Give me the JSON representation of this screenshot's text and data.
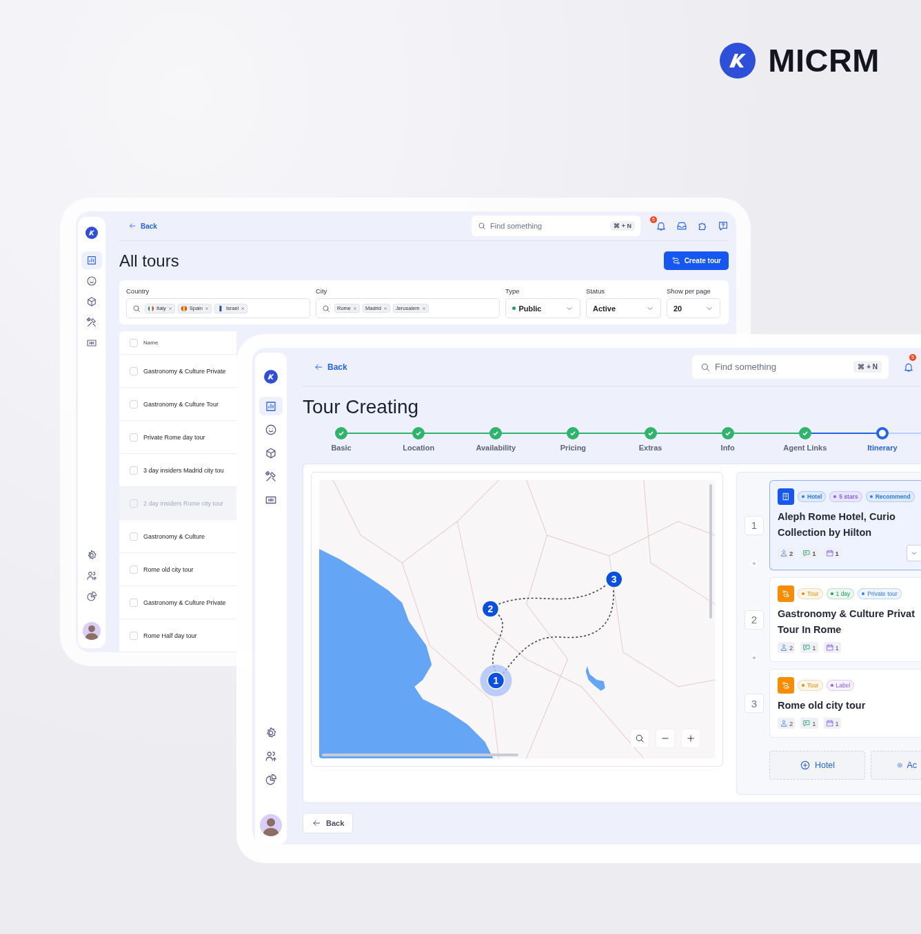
{
  "brand": {
    "name": "MICRM"
  },
  "back_window": {
    "back_link": "Back",
    "search": {
      "placeholder": "Find something",
      "shortcut": "⌘ + N"
    },
    "notification_count": "5",
    "title": "All tours",
    "create_button": "Create tour",
    "sidebar": {
      "items": [
        {
          "selected": true
        },
        {
          "selected": false
        },
        {
          "selected": false
        },
        {
          "selected": false
        },
        {
          "selected": false
        },
        {
          "selected": false
        },
        {
          "selected": false
        },
        {
          "selected": false
        }
      ]
    },
    "filters": {
      "country": {
        "label": "Country",
        "chips": [
          "Italy",
          "Spain",
          "Israel"
        ]
      },
      "city": {
        "label": "City",
        "chips": [
          "Rome",
          "Madrid",
          "Jerusalem"
        ]
      },
      "type": {
        "label": "Type",
        "value": "Public"
      },
      "status": {
        "label": "Status",
        "value": "Active"
      },
      "per_page": {
        "label": "Show per page",
        "value": "20"
      }
    },
    "table": {
      "columns": [
        "Name"
      ],
      "header_checked": false,
      "rows": [
        {
          "name": "Gastronomy & Culture Private",
          "checked": false,
          "disabled": false
        },
        {
          "name": "Gastronomy & Culture Tour",
          "checked": false,
          "disabled": false
        },
        {
          "name": "Private Rome day tour",
          "checked": false,
          "disabled": false
        },
        {
          "name": "3 day insiders Madrid city tou",
          "checked": false,
          "disabled": false
        },
        {
          "name": "2 day insiders Rome city tour",
          "checked": false,
          "disabled": true
        },
        {
          "name": "Gastronomy & Culture",
          "checked": false,
          "disabled": false
        },
        {
          "name": "Rome old city tour",
          "checked": false,
          "disabled": false
        },
        {
          "name": "Gastronomy & Culture Private",
          "checked": false,
          "disabled": false
        },
        {
          "name": "Rome Half day tour",
          "checked": false,
          "disabled": false
        }
      ]
    }
  },
  "front_window": {
    "back_link": "Back",
    "search": {
      "placeholder": "Find something",
      "shortcut": "⌘ + N"
    },
    "notification_count": "5",
    "title": "Tour Creating",
    "sidebar": {
      "items": [
        {
          "selected": true
        },
        {
          "selected": false
        },
        {
          "selected": false
        },
        {
          "selected": false
        },
        {
          "selected": false
        },
        {
          "selected": false
        },
        {
          "selected": false
        },
        {
          "selected": false
        }
      ]
    },
    "steps": [
      {
        "label": "Basic",
        "done": true,
        "selected": false
      },
      {
        "label": "Location",
        "done": true,
        "selected": false
      },
      {
        "label": "Availability",
        "done": true,
        "selected": false
      },
      {
        "label": "Pricing",
        "done": true,
        "selected": false
      },
      {
        "label": "Extras",
        "done": true,
        "selected": false
      },
      {
        "label": "Info",
        "done": true,
        "selected": false
      },
      {
        "label": "Agent Links",
        "done": true,
        "selected": false
      },
      {
        "label": "Itinerary",
        "done": false,
        "selected": true
      }
    ],
    "map": {
      "markers": [
        {
          "label": "1",
          "selected": true
        },
        {
          "label": "2",
          "selected": false
        },
        {
          "label": "3",
          "selected": false
        }
      ]
    },
    "itinerary": [
      {
        "number": "1",
        "kind": "hotel",
        "selected": true,
        "tags": [
          {
            "label": "Hotel",
            "color": "#2f7bf0"
          },
          {
            "label": "5 stars",
            "color": "#8b5cf6"
          },
          {
            "label": "Recommend",
            "color": "#2f7bf0"
          }
        ],
        "title": "Aleph Rome Hotel, Curio Collection by Hilton",
        "stats": [
          "2",
          "1",
          "1"
        ]
      },
      {
        "number": "2",
        "kind": "tour",
        "selected": false,
        "tags": [
          {
            "label": "Tour",
            "color": "#f08a00"
          },
          {
            "label": "1 day",
            "color": "#1f9d55"
          },
          {
            "label": "Private tour",
            "color": "#2f7bf0"
          }
        ],
        "title": "Gastronomy & Culture Privat Tour In Rome",
        "stats": [
          "2",
          "1",
          "1"
        ]
      },
      {
        "number": "3",
        "kind": "tour",
        "selected": false,
        "tags": [
          {
            "label": "Tour",
            "color": "#f08a00"
          },
          {
            "label": "Label",
            "color": "#8b5cf6"
          }
        ],
        "title": "Rome old city tour",
        "stats": [
          "2",
          "1",
          "1"
        ]
      }
    ],
    "add_buttons": [
      "Hotel",
      "Ac"
    ],
    "footer_back": "Back"
  }
}
